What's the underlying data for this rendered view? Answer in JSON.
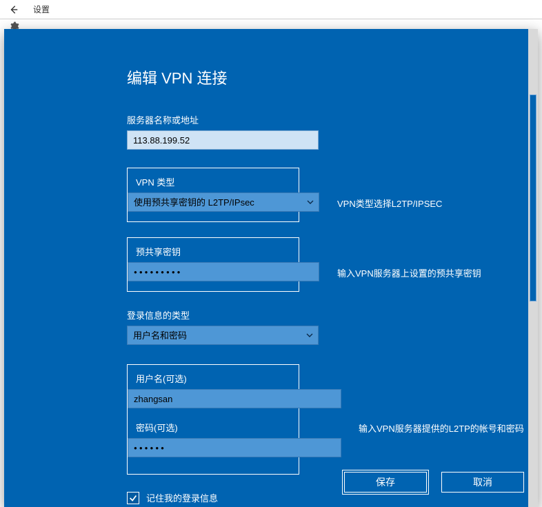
{
  "titlebar": {
    "title": "设置"
  },
  "understrip": {
    "label": ""
  },
  "dialog": {
    "title": "编辑 VPN 连接",
    "server": {
      "label": "服务器名称或地址",
      "value": "113.88.199.52"
    },
    "vpnType": {
      "label": "VPN 类型",
      "value": "使用预共享密钥的 L2TP/IPsec",
      "hint": "VPN类型选择L2TP/IPSEC"
    },
    "psk": {
      "label": "预共享密钥",
      "masked": "●●●●●●●●●",
      "hint": "输入VPN服务器上设置的预共享密钥"
    },
    "loginType": {
      "label": "登录信息的类型",
      "value": "用户名和密码"
    },
    "username": {
      "label": "用户名(可选)",
      "value": "zhangsan"
    },
    "password": {
      "label": "密码(可选)",
      "masked": "●●●●●●"
    },
    "credsHint": "输入VPN服务器提供的L2TP的帐号和密码",
    "remember": {
      "label": "记住我的登录信息",
      "checked": true
    },
    "buttons": {
      "save": "保存",
      "cancel": "取消"
    }
  }
}
